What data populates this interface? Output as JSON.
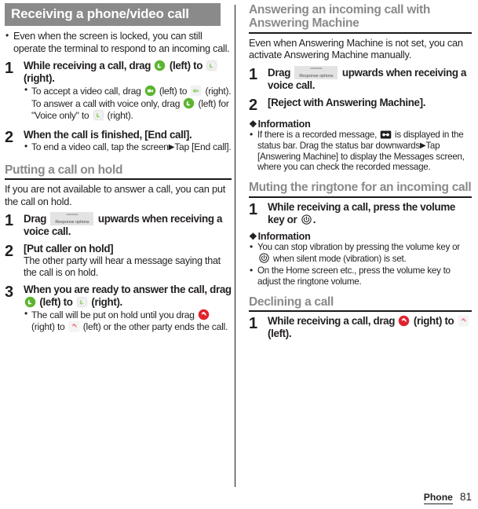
{
  "document": {
    "footer_label": "Phone",
    "page_number": "81"
  },
  "icons": {
    "answer_green": "answer-call-icon",
    "answer_ghost": "answer-call-target-icon",
    "video_green": "video-call-icon",
    "video_ghost": "video-call-target-icon",
    "decline_red": "decline-call-icon",
    "decline_ghost": "decline-call-target-icon",
    "power": "power-key-icon",
    "cassette": "answering-machine-status-icon",
    "response_options": "Response options",
    "floret": "❖",
    "triangle": "▶"
  },
  "left_column": {
    "banner": {
      "title": "Receiving a phone/video call"
    },
    "intro_bullets": [
      "Even when the screen is locked, you can still operate the terminal to respond to an incoming call."
    ],
    "steps": [
      {
        "number": "1",
        "title_parts": {
          "a": "While receiving a call, drag",
          "b": "(left) to",
          "c": "(right)."
        },
        "sub_bullets": [
          {
            "a": "To accept a video call, drag",
            "b": "(left) to",
            "c": "(right). To answer a call with voice only, drag",
            "d": "(left) for \"Voice only\" to",
            "e": "(right)."
          }
        ]
      },
      {
        "number": "2",
        "title": "When the call is finished, [End call].",
        "sub": {
          "a": "To end a video call, tap the screen",
          "b": "Tap [End call]."
        }
      }
    ],
    "section_hold": {
      "heading": "Putting a call on hold",
      "paragraph": "If you are not available to answer a call, you can put the call on hold.",
      "steps": [
        {
          "number": "1",
          "title_a": "Drag",
          "title_b": "upwards when receiving a voice call."
        },
        {
          "number": "2",
          "title": "[Put caller on hold]",
          "sub": "The other party will hear a message saying that the call is on hold."
        },
        {
          "number": "3",
          "title_a": "When you are ready to answer the call, drag",
          "title_b": "(left) to",
          "title_c": "(right).",
          "sub_a": "The call will be put on hold until you drag",
          "sub_b": "(right) to",
          "sub_c": "(left) or the other party ends the call."
        }
      ]
    }
  },
  "right_column": {
    "section_answering": {
      "heading": "Answering an incoming call with Answering Machine",
      "paragraph": "Even when Answering Machine is not set, you can activate Answering Machine manually.",
      "steps": [
        {
          "number": "1",
          "title_a": "Drag",
          "title_b": "upwards when receiving a voice call."
        },
        {
          "number": "2",
          "title": "[Reject with Answering Machine]."
        }
      ],
      "information": {
        "heading": "Information",
        "bullets": [
          {
            "a": "If there is a recorded message,",
            "b": "is displayed in the status bar. Drag the status bar downwards",
            "c": "Tap [Answering Machine] to display the Messages screen, where you can check the recorded message."
          }
        ]
      }
    },
    "section_muting": {
      "heading": "Muting the ringtone for an incoming call",
      "steps": [
        {
          "number": "1",
          "title_a": "While receiving a call, press the volume key or",
          "title_b": "."
        }
      ],
      "information": {
        "heading": "Information",
        "bullets": [
          {
            "a": "You can stop vibration by pressing the volume key or",
            "b": "when silent mode (vibration) is set."
          },
          {
            "a": "On the Home screen etc., press the volume key to adjust the ringtone volume."
          }
        ]
      }
    },
    "section_declining": {
      "heading": "Declining a call",
      "steps": [
        {
          "number": "1",
          "title_a": "While receiving a call, drag",
          "title_b": "(right) to",
          "title_c": "(left)."
        }
      ]
    }
  },
  "colors": {
    "banner_bg": "#8a8a8a",
    "heading_gray": "#8a8a8a",
    "rule_black": "#1a1a1a",
    "green": "#5cb531",
    "red": "#e0232e",
    "badge_bg": "#e3e3e3"
  }
}
